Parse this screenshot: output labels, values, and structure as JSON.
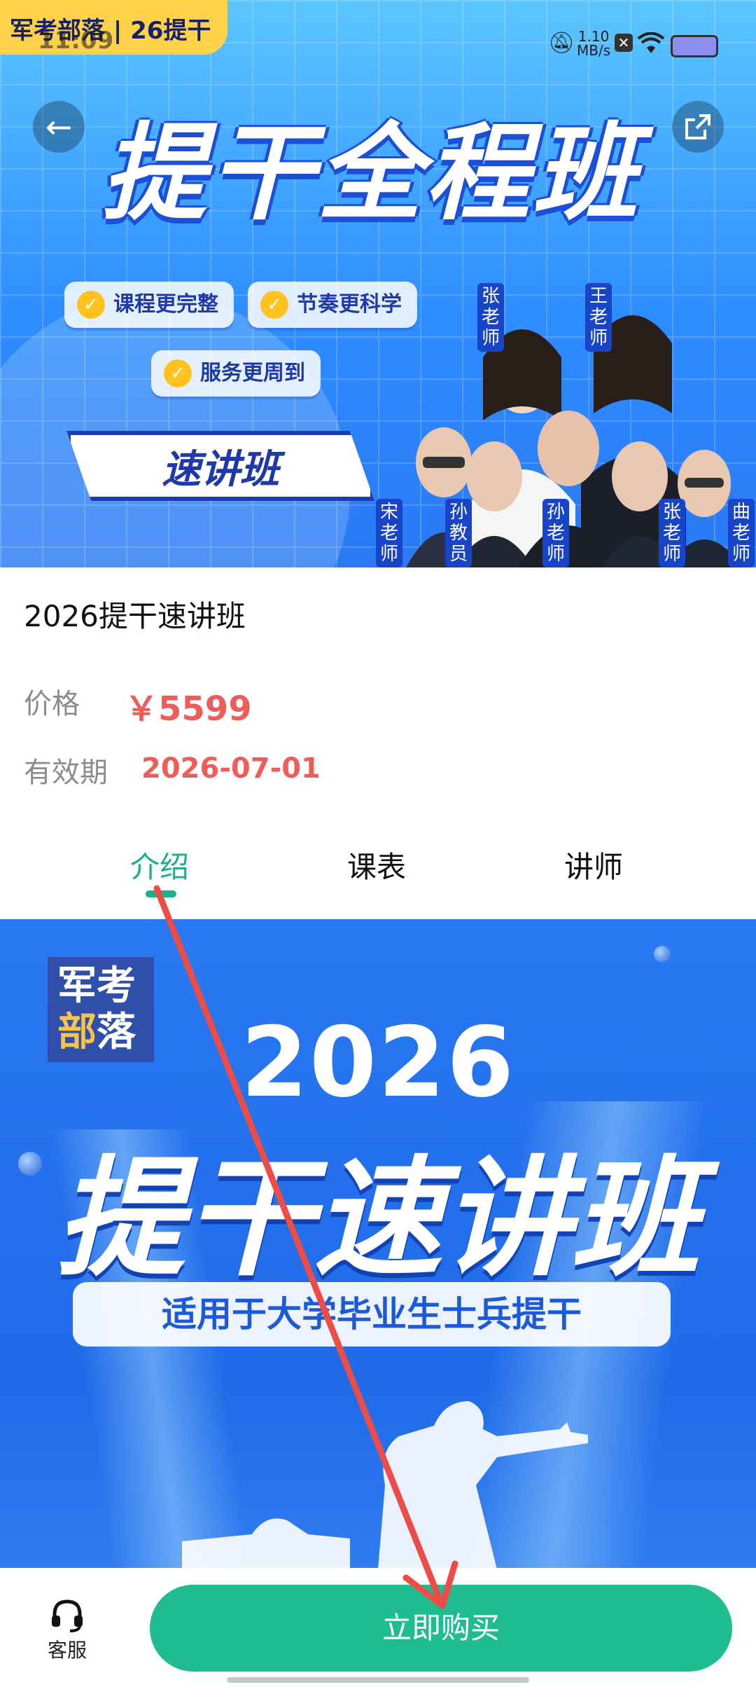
{
  "status_bar": {
    "time": "11:09",
    "speed_value": "1.10",
    "speed_unit": "MB/s"
  },
  "banner": {
    "top_tag": "军考部落 | 26提干",
    "title": "提干全程班",
    "features": [
      "课程更完整",
      "节奏更科学",
      "服务更周到"
    ],
    "flag": "速讲班",
    "teachers": [
      "张老师",
      "王老师",
      "宋老师",
      "孙教员",
      "孙老师",
      "张老师",
      "曲老师"
    ]
  },
  "course": {
    "title": "2026提干速讲班",
    "price_label": "价格",
    "price": "￥5599",
    "validity_label": "有效期",
    "validity": "2026-07-01"
  },
  "tabs": [
    "介绍",
    "课表",
    "讲师"
  ],
  "poster": {
    "logo_line1": "军考",
    "logo_line2a": "部",
    "logo_line2b": "落",
    "year": "2026",
    "title": "提干速讲班",
    "subtitle": "适用于大学毕业生士兵提干"
  },
  "bottom": {
    "service_label": "客服",
    "buy_label": "立即购买"
  },
  "colors": {
    "accent": "#1fbc8f",
    "price": "#ee5d57",
    "banner_blue": "#2d8dff",
    "tag_yellow": "#ffd24a"
  }
}
